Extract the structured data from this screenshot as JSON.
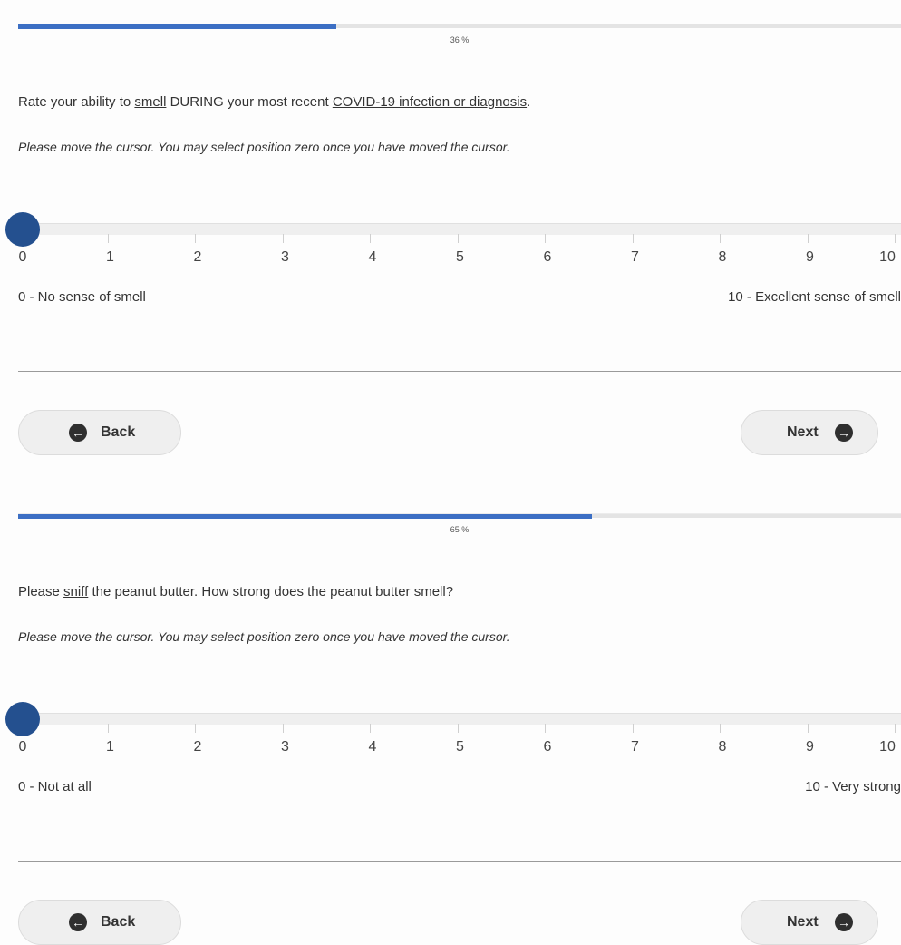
{
  "panels": [
    {
      "progress_text": "36 %",
      "progress_value": 0.36,
      "question": {
        "pre": "Rate your ability to ",
        "u1": "smell",
        "mid": " DURING your most recent ",
        "u2": "COVID-19 infection or diagnosis",
        "post": "."
      },
      "instruction": "Please move the cursor. You may select position zero once you have moved the cursor.",
      "slider": {
        "value": 0,
        "ticks": [
          "0",
          "1",
          "2",
          "3",
          "4",
          "5",
          "6",
          "7",
          "8",
          "9",
          "10"
        ],
        "left_anchor": "0 - No sense of smell",
        "right_anchor": "10 - Excellent sense of smell"
      },
      "nav": {
        "back": "Back",
        "next": "Next"
      },
      "colors": {
        "accent": "#3c6fc4",
        "handle": "#24508f"
      },
      "icons": {
        "back": "arrow-left-circle-icon",
        "next": "arrow-right-circle-icon"
      }
    },
    {
      "progress_text": "65 %",
      "progress_value": 0.65,
      "question": {
        "pre": "Please ",
        "u1": "sniff",
        "mid": " the peanut butter. How strong does the peanut butter smell?",
        "u2": "",
        "post": ""
      },
      "instruction": "Please move the cursor. You may select position zero once you have moved the cursor.",
      "slider": {
        "value": 0,
        "ticks": [
          "0",
          "1",
          "2",
          "3",
          "4",
          "5",
          "6",
          "7",
          "8",
          "9",
          "10"
        ],
        "left_anchor": "0 -  Not at all",
        "right_anchor": "10 - Very strong"
      },
      "nav": {
        "back": "Back",
        "next": "Next"
      },
      "colors": {
        "accent": "#3c6fc4",
        "handle": "#24508f"
      },
      "icons": {
        "back": "arrow-left-circle-icon",
        "next": "arrow-right-circle-icon"
      }
    }
  ]
}
